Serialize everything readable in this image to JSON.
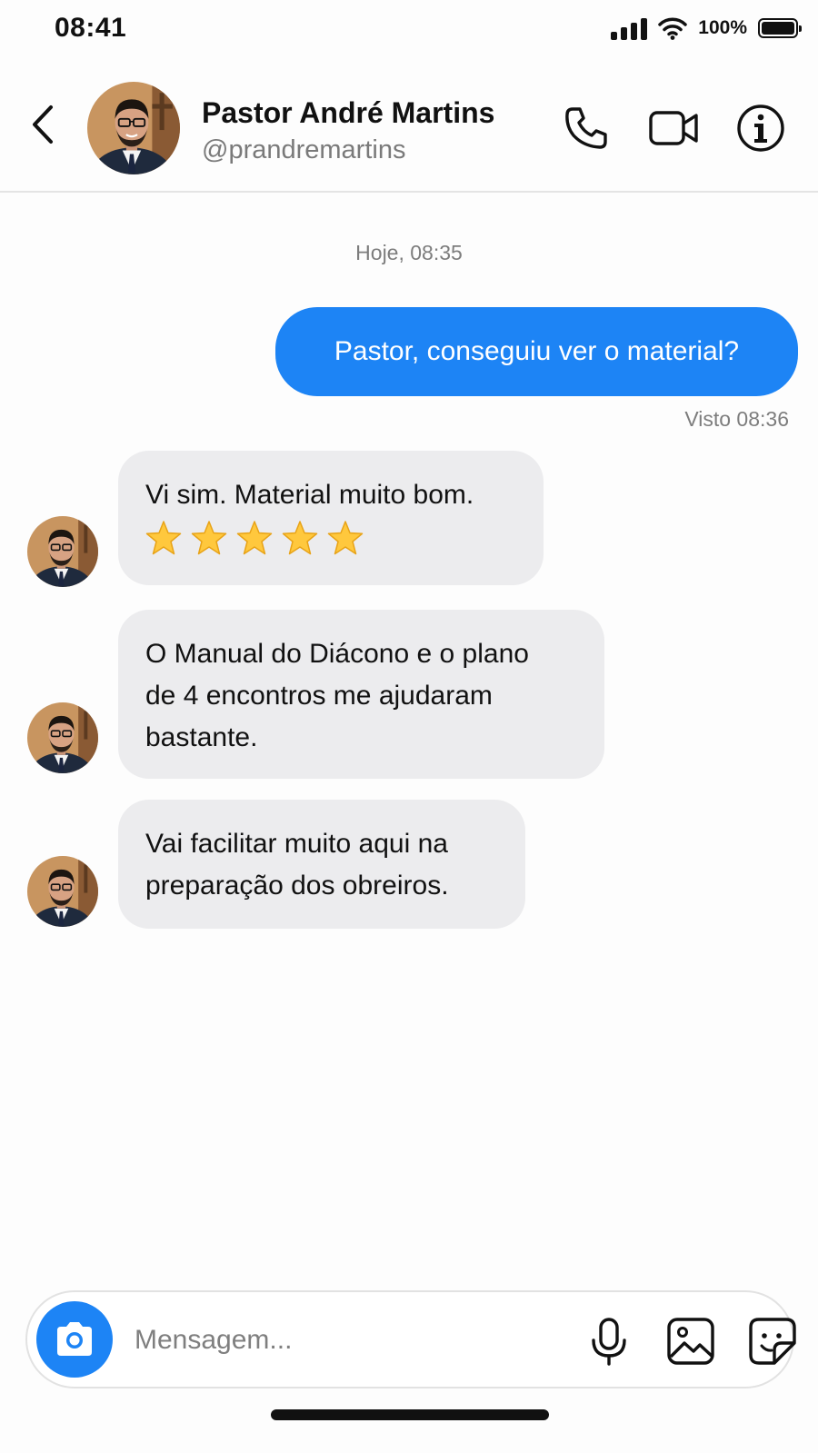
{
  "status_bar": {
    "time": "08:41",
    "battery": "100%"
  },
  "header": {
    "contact_name": "Pastor André Martins",
    "contact_handle": "@prandremartins",
    "icons": [
      "back-chevron-icon",
      "phone-icon",
      "video-camera-icon",
      "info-icon"
    ]
  },
  "chat": {
    "date_label": "Hoje, 08:35",
    "outgoing": {
      "text": "Pastor, conseguiu ver o material?",
      "status": "Visto 08:36"
    },
    "incoming": [
      {
        "lines": [
          "Vi sim. Material muito bom."
        ],
        "stars": 5
      },
      {
        "lines": [
          "O Manual do Diácono e o plano",
          "de 4 encontros me ajudaram",
          "bastante."
        ]
      },
      {
        "lines": [
          "Vai facilitar muito aqui na",
          "preparação dos obreiros."
        ]
      }
    ]
  },
  "composer": {
    "placeholder": "Mensagem...",
    "icons": [
      "camera-icon",
      "microphone-icon",
      "image-icon",
      "sticker-icon"
    ]
  },
  "colors": {
    "accent_blue": "#1d84f5",
    "incoming_bubble": "#ececee",
    "secondary_text": "#7d7d7d"
  }
}
